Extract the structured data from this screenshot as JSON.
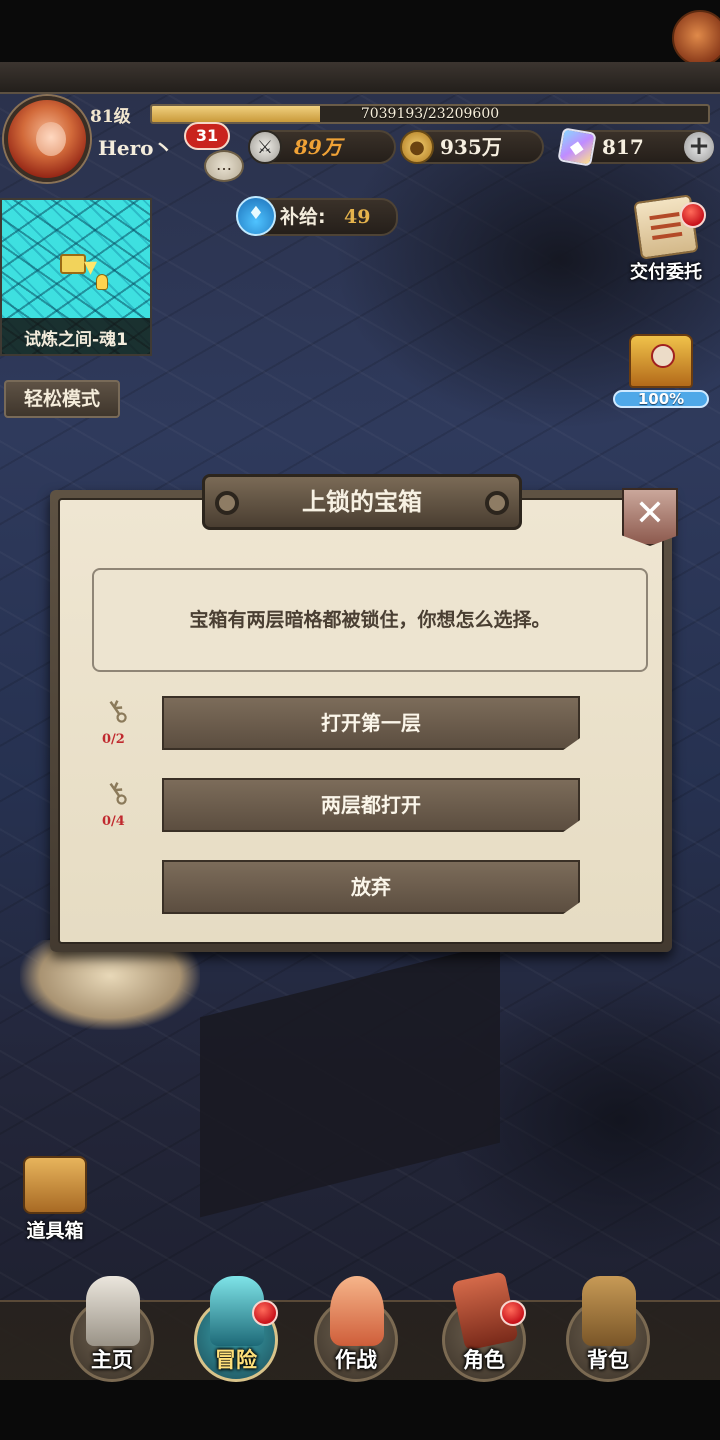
{
  "player": {
    "level": "81级",
    "exp_text": "7039193/23209600",
    "exp_fraction": 0.303,
    "name": "Hero丶",
    "chat_unread": "31"
  },
  "resources": {
    "power": "89万",
    "gold": "935万",
    "gems": "817",
    "supply_label": "补给:",
    "supply_value": "49"
  },
  "minimap": {
    "location": "试炼之间-魂1"
  },
  "mode_button": "轻松模式",
  "side": {
    "commission_label": "交付委托",
    "chest_progress": "100%"
  },
  "dialog": {
    "title": "上锁的宝箱",
    "close_symbol": "✕",
    "message": "宝箱有两层暗格都被锁住，你想怎么选择。",
    "options": [
      {
        "label": "打开第一层",
        "key_count": "0/2"
      },
      {
        "label": "两层都打开",
        "key_count": "0/4"
      },
      {
        "label": "放弃"
      }
    ]
  },
  "toolbox_label": "道具箱",
  "nav": [
    {
      "label": "主页"
    },
    {
      "label": "冒险"
    },
    {
      "label": "作战"
    },
    {
      "label": "角色"
    },
    {
      "label": "背包"
    }
  ]
}
